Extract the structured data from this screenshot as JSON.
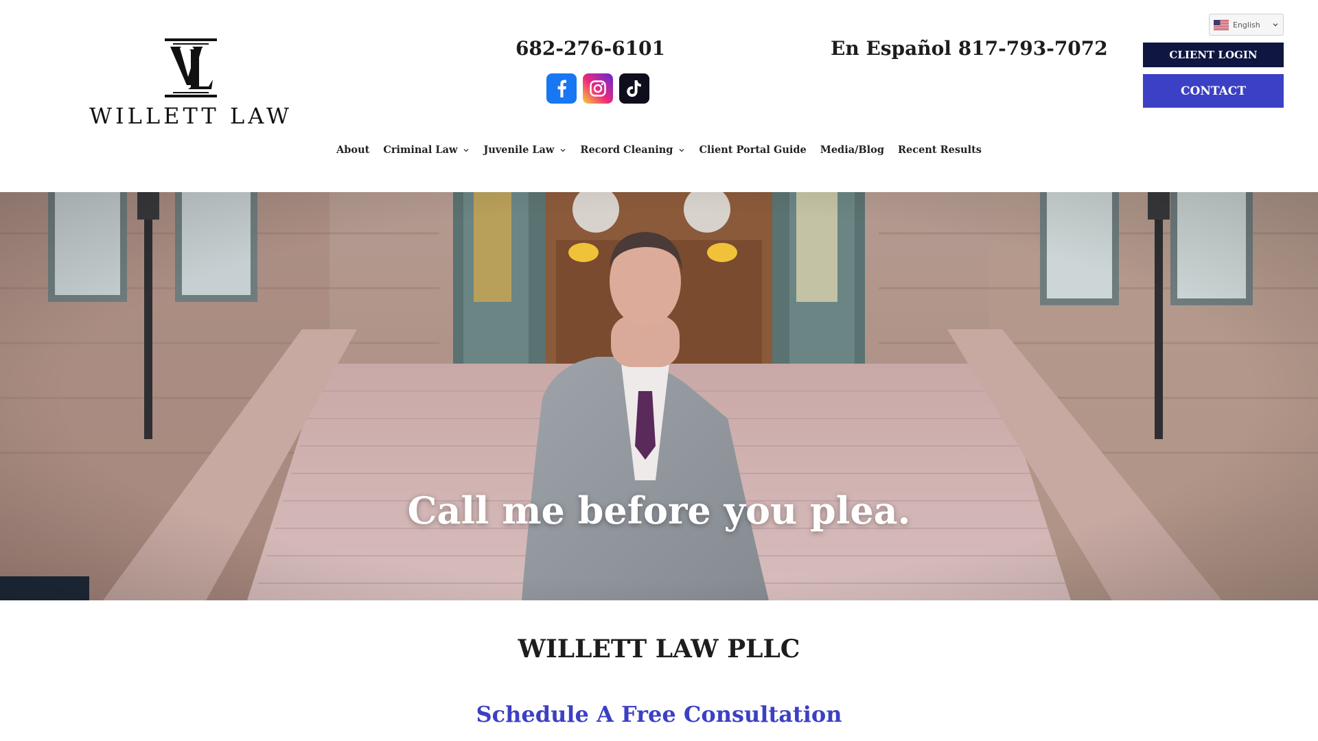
{
  "logo": {
    "text": "WILLETT LAW"
  },
  "contact": {
    "phone": "682-276-6101",
    "spanish_phone": "En Español 817-793-7072"
  },
  "social": [
    {
      "name": "facebook-icon",
      "color": "#1877f2"
    },
    {
      "name": "instagram-icon",
      "color": "#e1306c"
    },
    {
      "name": "tiktok-icon",
      "color": "#0e0e1c"
    }
  ],
  "language": {
    "selected": "English",
    "flag": "us-flag-icon"
  },
  "buttons": {
    "client_login": "CLIENT LOGIN",
    "contact": "CONTACT"
  },
  "nav": {
    "items": [
      {
        "label": "About",
        "dropdown": false
      },
      {
        "label": "Criminal Law",
        "dropdown": true
      },
      {
        "label": "Juvenile Law",
        "dropdown": true
      },
      {
        "label": "Record Cleaning",
        "dropdown": true
      },
      {
        "label": "Client Portal Guide",
        "dropdown": false
      },
      {
        "label": "Media/Blog",
        "dropdown": false
      },
      {
        "label": "Recent Results",
        "dropdown": false
      }
    ]
  },
  "hero": {
    "tagline": "Call me before you plea."
  },
  "main": {
    "firm_name": "WILLETT LAW PLLC",
    "cta": "Schedule A Free Consultation"
  },
  "colors": {
    "navy": "#0f1640",
    "accent_blue": "#3c40c4",
    "text": "#1d1d1d"
  }
}
